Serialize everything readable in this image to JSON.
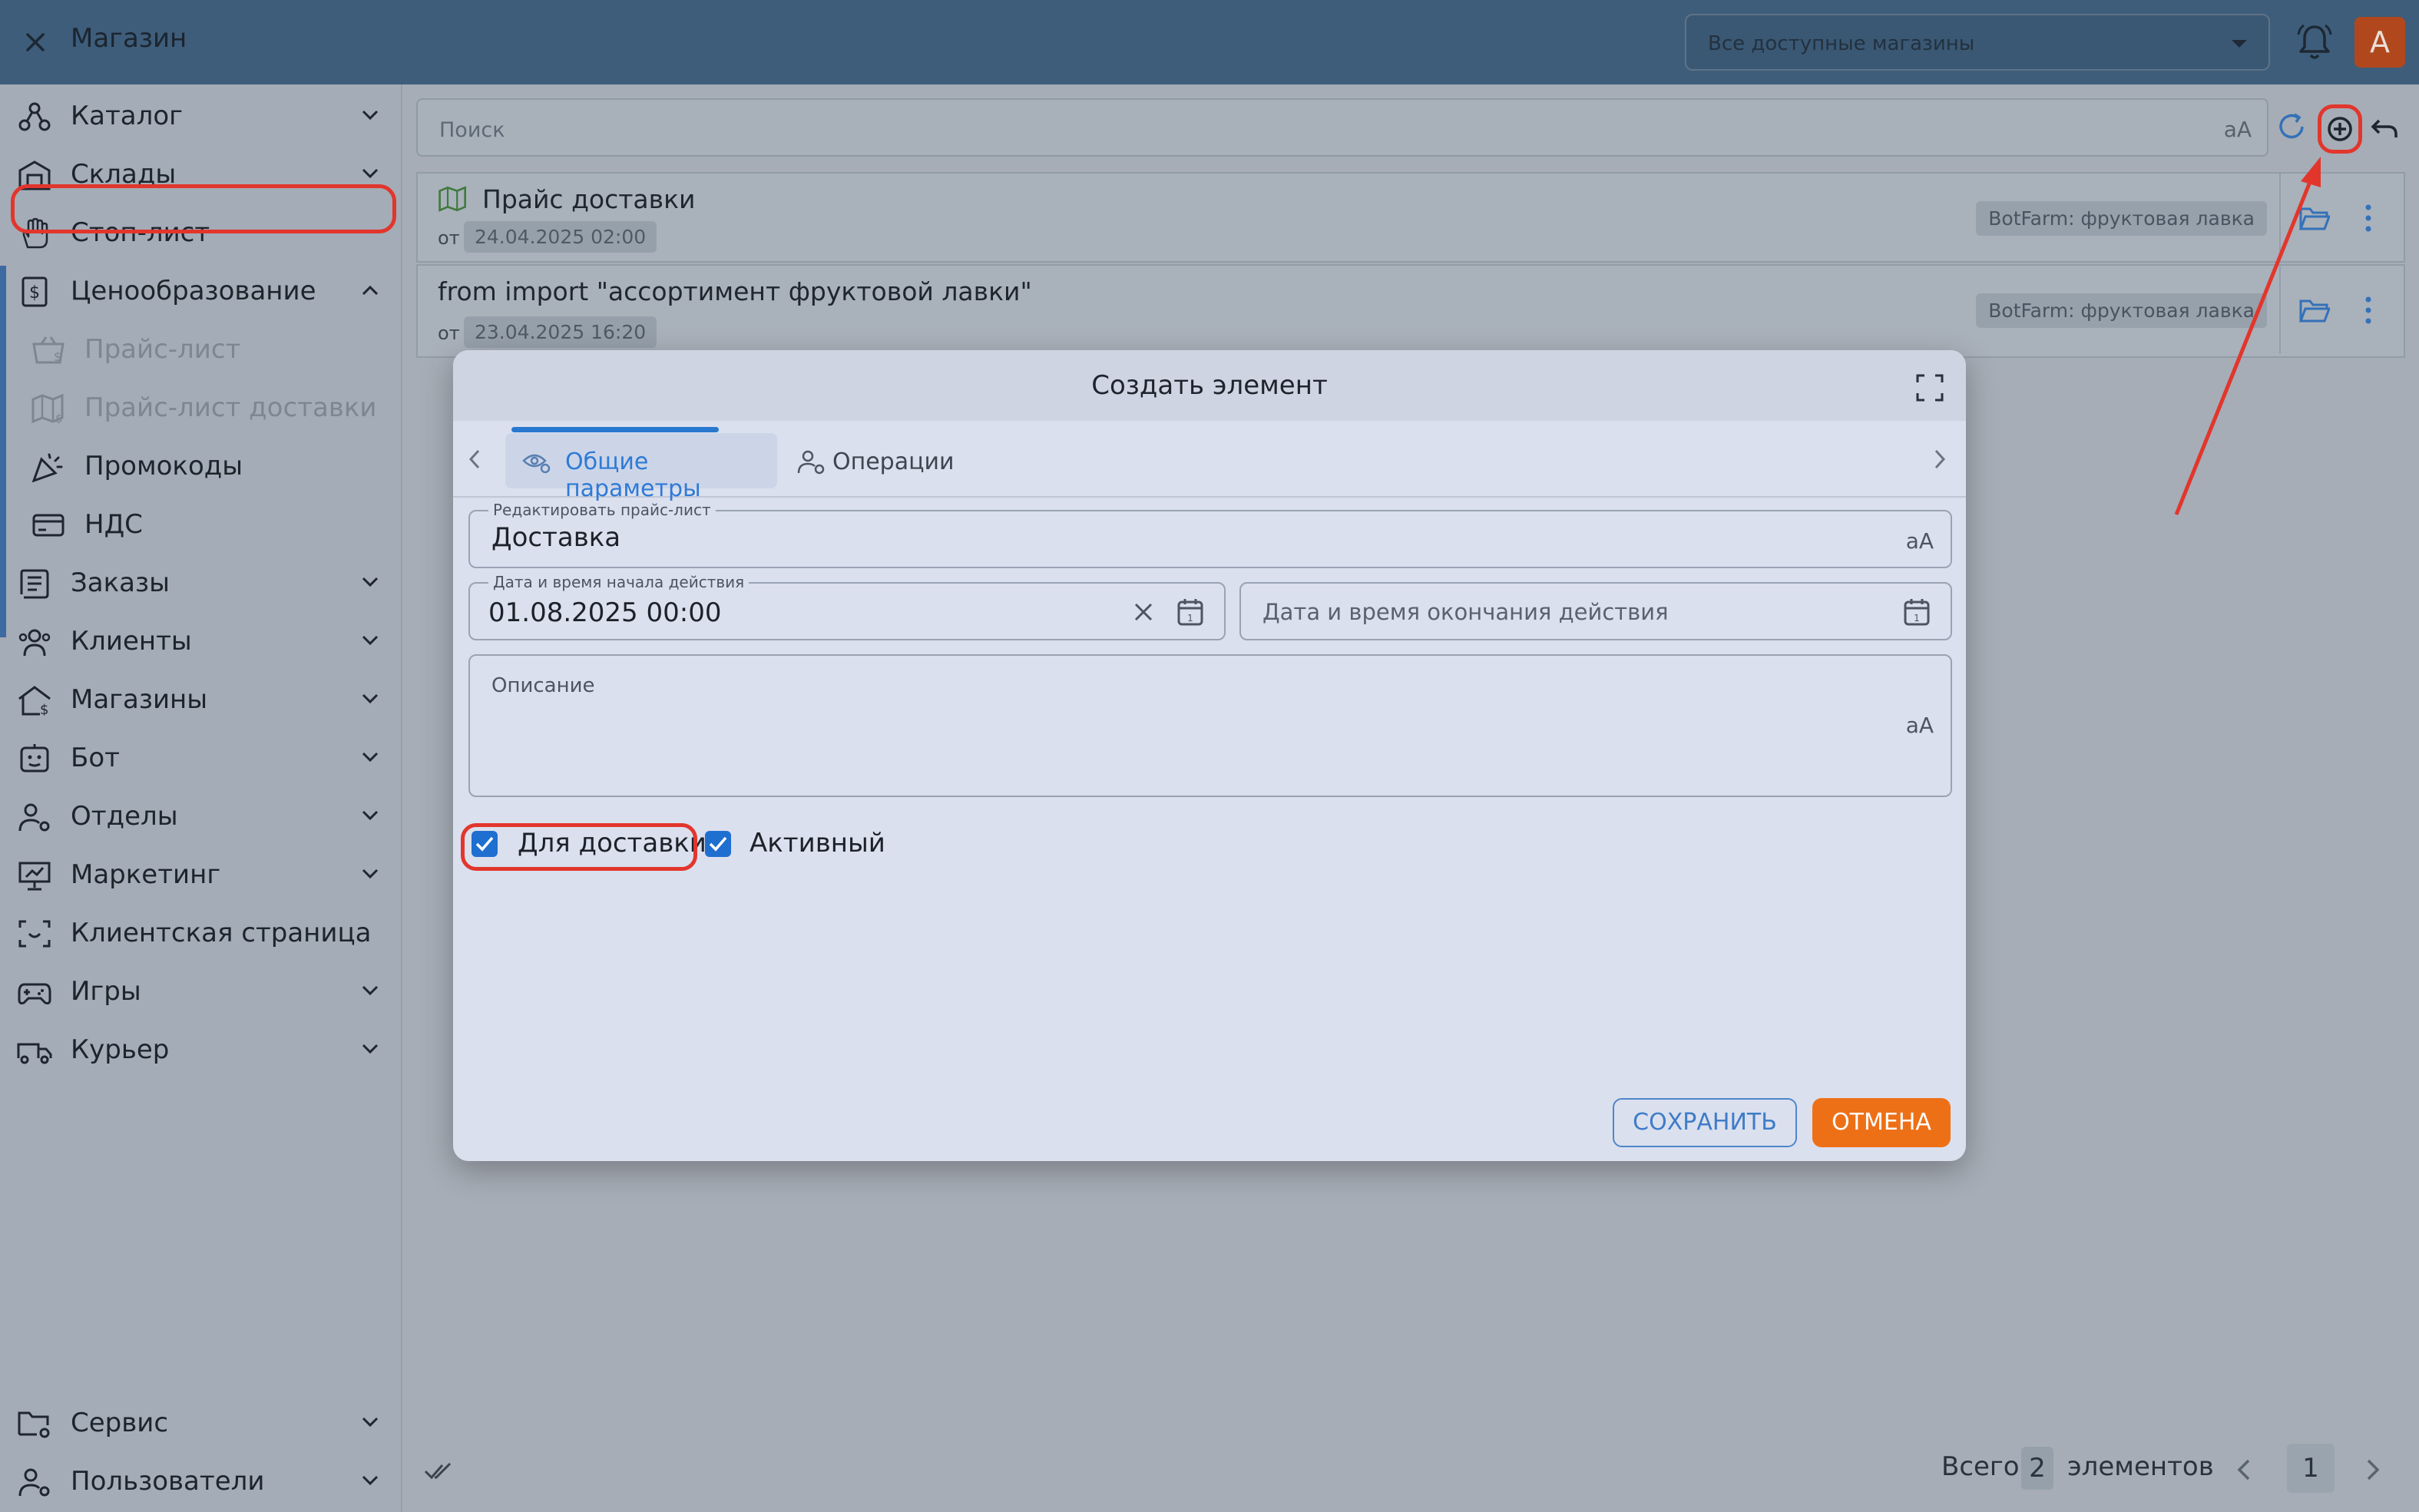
{
  "app": {
    "title": "Магазин",
    "store_select": "Все доступные магазины",
    "avatar_letter": "A"
  },
  "sidebar": {
    "items": [
      {
        "label": "Каталог",
        "icon": "catalog-icon",
        "chevron": true
      },
      {
        "label": "Склады",
        "icon": "warehouse-icon",
        "chevron": true
      },
      {
        "label": "Стоп-лист",
        "icon": "hand-icon",
        "chevron": false
      },
      {
        "label": "Ценообразование",
        "icon": "price-tag-icon",
        "chevron": true,
        "expanded": true
      },
      {
        "label": "Прайс-лист",
        "icon": "basket-price-icon",
        "sub": true,
        "dim": true
      },
      {
        "label": "Прайс-лист доставки",
        "icon": "map-price-icon",
        "sub": true,
        "dim": true
      },
      {
        "label": "Промокоды",
        "icon": "party-icon",
        "sub": true
      },
      {
        "label": "НДС",
        "icon": "card-icon",
        "sub": true
      },
      {
        "label": "Заказы",
        "icon": "receipt-icon",
        "chevron": true
      },
      {
        "label": "Клиенты",
        "icon": "clients-icon",
        "chevron": true
      },
      {
        "label": "Магазины",
        "icon": "shop-icon",
        "chevron": true
      },
      {
        "label": "Бот",
        "icon": "bot-icon",
        "chevron": true
      },
      {
        "label": "Отделы",
        "icon": "departments-icon",
        "chevron": true
      },
      {
        "label": "Маркетинг",
        "icon": "presentation-icon",
        "chevron": true
      },
      {
        "label": "Клиентская страница",
        "icon": "page-icon",
        "chevron": false
      },
      {
        "label": "Игры",
        "icon": "gamepad-icon",
        "chevron": true
      },
      {
        "label": "Курьер",
        "icon": "truck-icon",
        "chevron": true
      }
    ],
    "bottom_items": [
      {
        "label": "Сервис",
        "icon": "service-folder-icon",
        "chevron": true
      },
      {
        "label": "Пользователи",
        "icon": "users-icon",
        "chevron": true
      }
    ]
  },
  "search": {
    "placeholder": "Поиск",
    "case_toggle": "aA"
  },
  "list": {
    "rows": [
      {
        "name": "Прайс доставки",
        "from_label": "от",
        "date": "24.04.2025 02:00",
        "store": "BotFarm: фруктовая лавка"
      },
      {
        "name": "from import \"ассортимент фруктовой лавки\"",
        "from_label": "от",
        "date": "23.04.2025 16:20",
        "store": "BotFarm: фруктовая лавка"
      }
    ]
  },
  "footer": {
    "total_label": "Всего",
    "total_count": "2",
    "elements_label": "элементов",
    "page": "1"
  },
  "modal": {
    "title": "Создать элемент",
    "tabs": [
      {
        "label": "Общие параметры",
        "active": true
      },
      {
        "label": "Операции",
        "active": false
      }
    ],
    "fields": {
      "name_label": "Редактировать прайс-лист",
      "name_value": "Доставка",
      "start_label": "Дата и время начала действия",
      "start_value": "01.08.2025 00:00",
      "end_placeholder": "Дата и время окончания действия",
      "description_label": "Описание",
      "case_toggle": "aA"
    },
    "checkboxes": [
      {
        "label": "Для доставки",
        "checked": true
      },
      {
        "label": "Активный",
        "checked": true
      }
    ],
    "buttons": {
      "save": "СОХРАНИТЬ",
      "cancel": "ОТМЕНА"
    }
  },
  "colors": {
    "accent": "#2878d0",
    "cancel": "#ee7016",
    "annotation": "#e2362d",
    "topbar": "#3e5d7a"
  }
}
